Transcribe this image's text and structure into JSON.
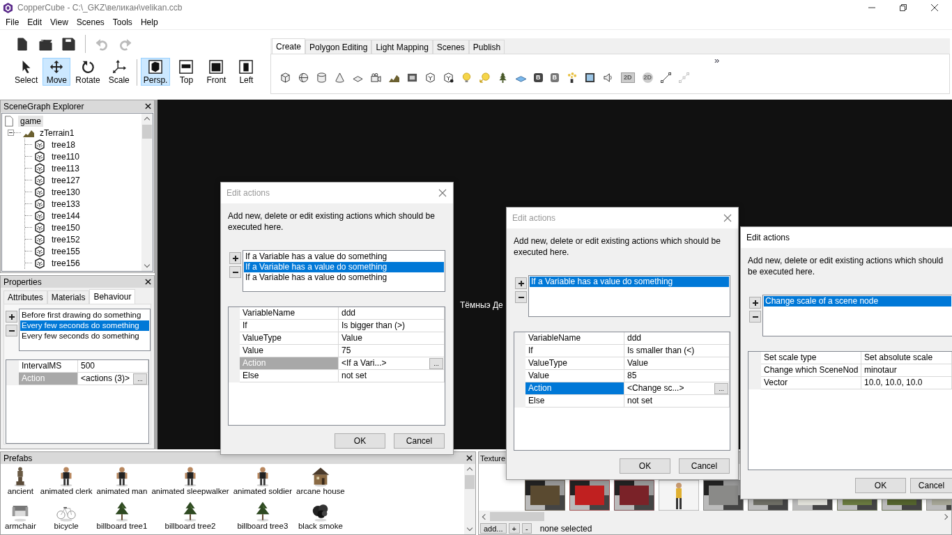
{
  "window": {
    "title": "CopperCube - C:\\_GKZ\\великан\\velikan.ccb"
  },
  "menu": [
    "File",
    "Edit",
    "View",
    "Scenes",
    "Tools",
    "Help"
  ],
  "file_buttons": [
    {
      "kind": "new",
      "disabled": false
    },
    {
      "kind": "open",
      "disabled": false
    },
    {
      "kind": "save",
      "disabled": false
    },
    {
      "kind": "undo",
      "disabled": true
    },
    {
      "kind": "redo",
      "disabled": true
    }
  ],
  "tools": [
    {
      "label": "Select",
      "kind": "select",
      "selected": false
    },
    {
      "label": "Move",
      "kind": "move",
      "selected": true
    },
    {
      "label": "Rotate",
      "kind": "rotate",
      "selected": false
    },
    {
      "label": "Scale",
      "kind": "scale",
      "selected": false
    }
  ],
  "views": [
    {
      "label": "Persp.",
      "kind": "perspective",
      "selected": true
    },
    {
      "label": "Top",
      "kind": "top",
      "selected": false
    },
    {
      "label": "Front",
      "kind": "front",
      "selected": false
    },
    {
      "label": "Left",
      "kind": "left",
      "selected": false
    }
  ],
  "ribbon": {
    "tabs": [
      {
        "label": "Create",
        "selected": true
      },
      {
        "label": "Polygon Editing",
        "selected": false
      },
      {
        "label": "Light Mapping",
        "selected": false
      },
      {
        "label": "Scenes",
        "selected": false
      },
      {
        "label": "Publish",
        "selected": false
      }
    ],
    "overflow": "»",
    "items": [
      {
        "kind": "cube"
      },
      {
        "kind": "sphere"
      },
      {
        "kind": "cylinder"
      },
      {
        "kind": "cone"
      },
      {
        "kind": "plane"
      },
      {
        "kind": "camera"
      },
      {
        "kind": "terrain"
      },
      {
        "kind": "skybox"
      },
      {
        "kind": "mesh"
      },
      {
        "kind": "animated-mesh"
      },
      {
        "kind": "light"
      },
      {
        "kind": "spotlight"
      },
      {
        "kind": "tree"
      },
      {
        "kind": "water"
      },
      {
        "kind": "billboard",
        "text": "B"
      },
      {
        "kind": "billboard-light",
        "text": "B"
      },
      {
        "kind": "particles"
      },
      {
        "kind": "frame"
      },
      {
        "kind": "sound"
      },
      {
        "kind": "overlay",
        "text": "2D"
      },
      {
        "kind": "overlay-round",
        "text": "2D"
      },
      {
        "kind": "path"
      },
      {
        "kind": "path-grid"
      }
    ]
  },
  "scene_graph": {
    "title": "SceneGraph Explorer",
    "nodes": [
      {
        "label": "game",
        "kind": "scene",
        "selected": true
      },
      {
        "label": "zTerrain1",
        "kind": "terrain",
        "selected": false,
        "expanded": true,
        "children": [
          {
            "label": "tree18",
            "kind": "mesh",
            "selected": false
          },
          {
            "label": "tree110",
            "kind": "mesh",
            "selected": false
          },
          {
            "label": "tree113",
            "kind": "mesh",
            "selected": false
          },
          {
            "label": "tree127",
            "kind": "mesh",
            "selected": false
          },
          {
            "label": "tree130",
            "kind": "mesh",
            "selected": false
          },
          {
            "label": "tree133",
            "kind": "mesh",
            "selected": false
          },
          {
            "label": "tree144",
            "kind": "mesh",
            "selected": false
          },
          {
            "label": "tree150",
            "kind": "mesh",
            "selected": false
          },
          {
            "label": "tree152",
            "kind": "mesh",
            "selected": false
          },
          {
            "label": "tree155",
            "kind": "mesh",
            "selected": false
          },
          {
            "label": "tree156",
            "kind": "mesh",
            "selected": false
          }
        ]
      }
    ]
  },
  "properties": {
    "title": "Properties",
    "tabs": [
      {
        "label": "Attributes",
        "selected": false
      },
      {
        "label": "Materials",
        "selected": false
      },
      {
        "label": "Behaviour",
        "selected": true
      }
    ],
    "behaviours": [
      {
        "label": "Before first drawing do something",
        "selected": false
      },
      {
        "label": "Every few seconds do something",
        "selected": true
      },
      {
        "label": "Every few seconds do something",
        "selected": false
      }
    ],
    "grid_focused": false,
    "rows": [
      {
        "name": "IntervalMS",
        "value": "500",
        "selected": false
      },
      {
        "name": "Action",
        "value": "<actions (3)>",
        "button": "...",
        "selected": true
      }
    ]
  },
  "viewport": {
    "caption": "Тёмныэ Де"
  },
  "prefabs": {
    "title": "Prefabs",
    "items": [
      "ancient",
      "animated clerk",
      "animated man",
      "animated sleepwalker",
      "animated soldier",
      "arcane house",
      "armchair",
      "bicycle",
      "billboard tree1",
      "billboard tree2",
      "billboard tree3",
      "black smoke"
    ]
  },
  "textures": {
    "title": "Texture",
    "add_button": "add...",
    "plus_button": "+",
    "minus_button": "-",
    "status": "none selected"
  },
  "dialogs": [
    {
      "title": "Edit actions",
      "active": false,
      "closable": true,
      "description": "Add new, delete or edit existing actions which should be executed here.",
      "actions": [
        {
          "label": "If a Variable has a value do something",
          "selected": false
        },
        {
          "label": "If a Variable has a value do something",
          "selected": true
        },
        {
          "label": "If a Variable has a value do something",
          "selected": false
        }
      ],
      "grid_focused": false,
      "rows": [
        {
          "name": "VariableName",
          "value": "ddd",
          "selected": false
        },
        {
          "name": "If",
          "value": "Is bigger than (>)",
          "selected": false
        },
        {
          "name": "ValueType",
          "value": "Value",
          "selected": false
        },
        {
          "name": "Value",
          "value": "75",
          "selected": false
        },
        {
          "name": "Action",
          "value": "<If a Vari...>",
          "button": "...",
          "selected": true
        },
        {
          "name": "Else",
          "value": "not set",
          "selected": false
        }
      ],
      "buttons": [
        "OK",
        "Cancel"
      ]
    },
    {
      "title": "Edit actions",
      "active": false,
      "closable": true,
      "description": "Add new, delete or edit existing actions which should be executed here.",
      "actions": [
        {
          "label": "If a Variable has a value do something",
          "selected": true
        }
      ],
      "grid_focused": true,
      "rows": [
        {
          "name": "VariableName",
          "value": "ddd",
          "selected": false
        },
        {
          "name": "If",
          "value": "Is smaller than (<)",
          "selected": false
        },
        {
          "name": "ValueType",
          "value": "Value",
          "selected": false
        },
        {
          "name": "Value",
          "value": "85",
          "selected": false
        },
        {
          "name": "Action",
          "value": "<Change sc...>",
          "button": "...",
          "selected": true
        },
        {
          "name": "Else",
          "value": "not set",
          "selected": false
        }
      ],
      "buttons": [
        "OK",
        "Cancel"
      ]
    },
    {
      "title": "Edit actions",
      "active": true,
      "closable": false,
      "description": "Add new, delete or edit existing actions which should be executed here.",
      "actions": [
        {
          "label": "Change scale of a scene node",
          "selected": true
        }
      ],
      "rows": [
        {
          "name": "Set scale type",
          "value": "Set absolute scale",
          "selected": false
        },
        {
          "name": "Change which SceneNod",
          "value": "minotaur",
          "selected": false
        },
        {
          "name": "Vector",
          "value": "10.0, 10.0, 10.0",
          "selected": false
        }
      ],
      "buttons": [
        "OK",
        "Cancel"
      ]
    }
  ]
}
